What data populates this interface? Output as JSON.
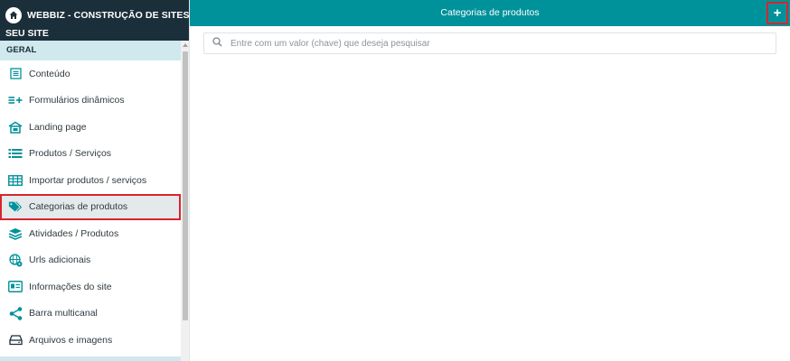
{
  "brand": {
    "title": "WEBBIZ - CONSTRUÇÃO DE SITES - CRIE",
    "subtitle": "SEU SITE"
  },
  "section_label": "GERAL",
  "menu": [
    {
      "label": "Conteúdo",
      "icon": "document-icon"
    },
    {
      "label": "Formulários dinâmicos",
      "icon": "list-add-icon"
    },
    {
      "label": "Landing page",
      "icon": "landing-page-icon"
    },
    {
      "label": "Produtos / Serviços",
      "icon": "list-icon"
    },
    {
      "label": "Importar produtos / serviços",
      "icon": "table-icon"
    },
    {
      "label": "Categorias de produtos",
      "icon": "tags-icon",
      "active": true
    },
    {
      "label": "Atividades / Produtos",
      "icon": "layers-icon"
    },
    {
      "label": "Urls adicionais",
      "icon": "globe-gear-icon"
    },
    {
      "label": "Informações do site",
      "icon": "id-card-icon"
    },
    {
      "label": "Barra multicanal",
      "icon": "share-icon"
    },
    {
      "label": "Arquivos e imagens",
      "icon": "drive-icon"
    }
  ],
  "topbar": {
    "title": "Categorias de produtos",
    "add_label": "+"
  },
  "search": {
    "placeholder": "Entre com um valor (chave) que deseja pesquisar",
    "value": ""
  },
  "colors": {
    "sidebar_header": "#1b2f3a",
    "topbar": "#00929a",
    "section": "#cfe9ee",
    "icon": "#00929a",
    "highlight": "#d9252c"
  }
}
